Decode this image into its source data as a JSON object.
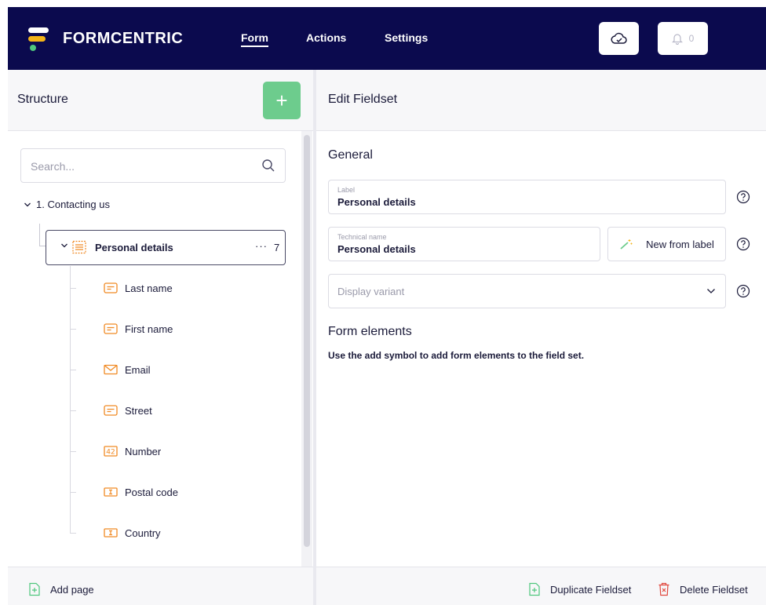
{
  "app": {
    "brand": "FORMCENTRIC",
    "nav": [
      {
        "label": "Form",
        "active": true
      },
      {
        "label": "Actions",
        "active": false
      },
      {
        "label": "Settings",
        "active": false
      }
    ],
    "notifications_count": "0"
  },
  "structure": {
    "title": "Structure",
    "add_symbol": "+",
    "search_placeholder": "Search...",
    "page_label": "1. Contacting us",
    "fieldset": {
      "label": "Personal details",
      "more": "···",
      "count": "7"
    },
    "children": [
      {
        "label": "Last name",
        "icon": "text-field-icon"
      },
      {
        "label": "First name",
        "icon": "text-field-icon"
      },
      {
        "label": "Email",
        "icon": "email-icon"
      },
      {
        "label": "Street",
        "icon": "text-field-icon"
      },
      {
        "label": "Number",
        "icon": "number-field-icon"
      },
      {
        "label": "Postal code",
        "icon": "input-field-icon"
      },
      {
        "label": "Country",
        "icon": "input-field-icon"
      }
    ],
    "add_page_label": "Add page"
  },
  "editor": {
    "title": "Edit Fieldset",
    "general_title": "General",
    "label_field": {
      "label": "Label",
      "value": "Personal details"
    },
    "technical_field": {
      "label": "Technical name",
      "value": "Personal details"
    },
    "new_from_label": "New from label",
    "display_variant_placeholder": "Display variant",
    "form_elements_title": "Form elements",
    "form_elements_hint": "Use the add symbol to add form elements to the field set.",
    "duplicate_label": "Duplicate Fieldset",
    "delete_label": "Delete Fieldset"
  },
  "colors": {
    "topbar": "#0b0a4e",
    "accent_green": "#6dcc8d",
    "icon_orange": "#f08a24",
    "delete_red": "#e0473d"
  }
}
